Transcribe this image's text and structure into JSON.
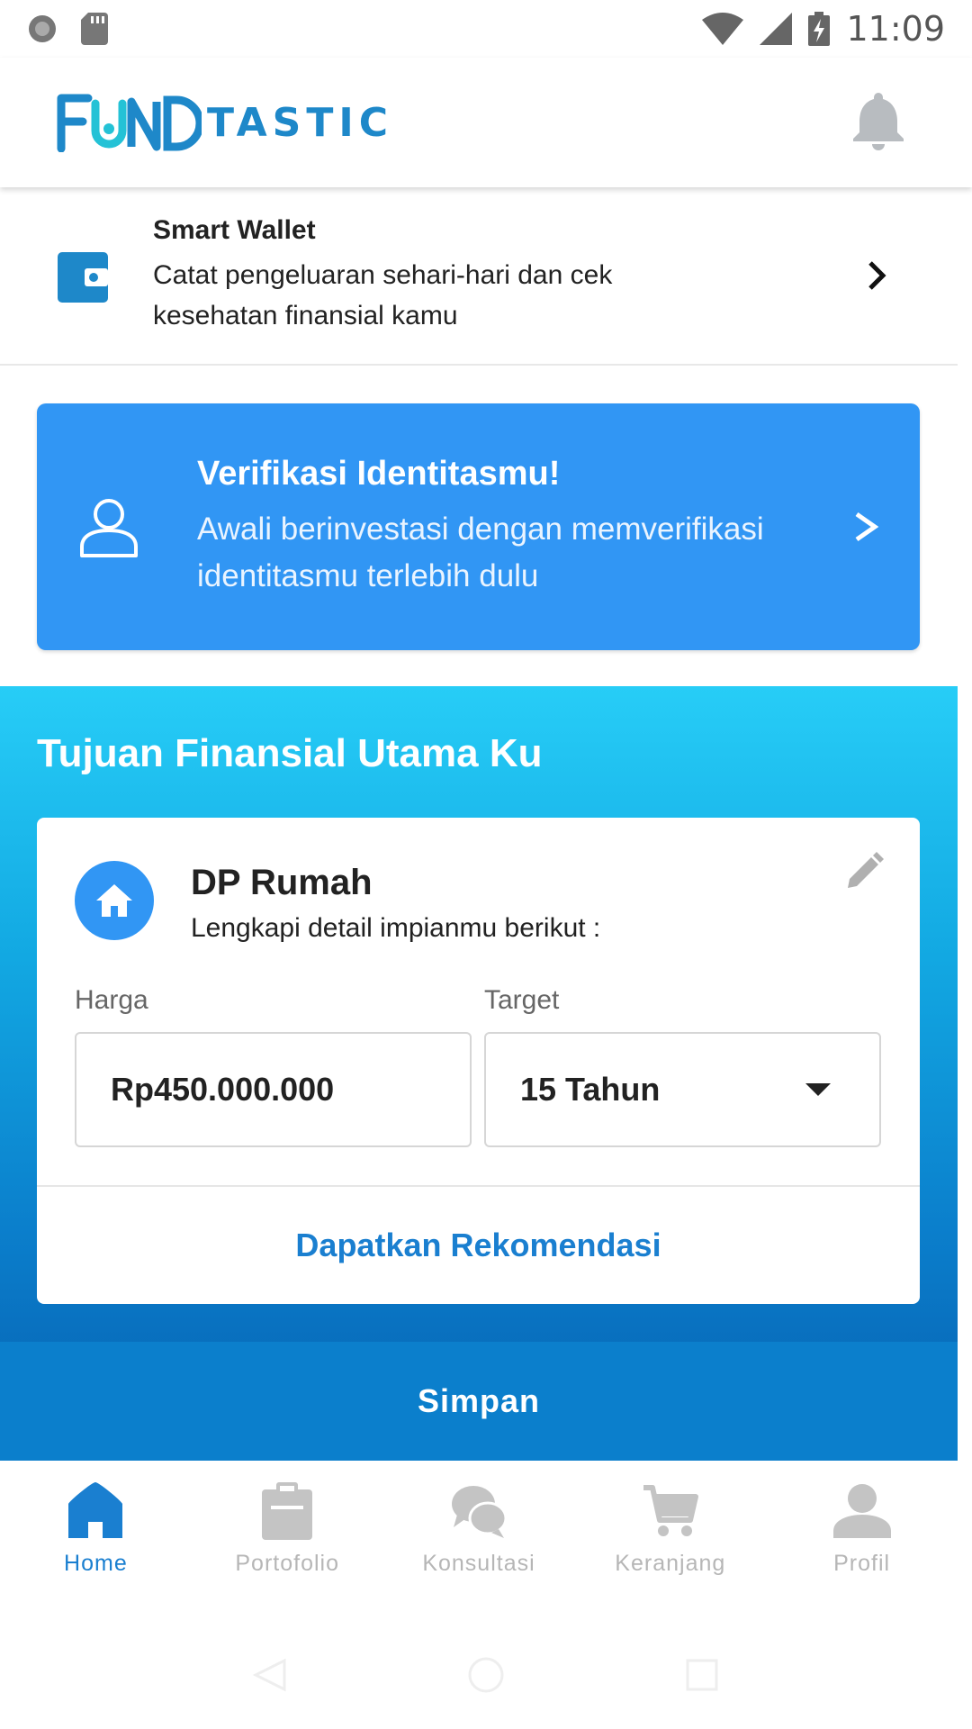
{
  "status_bar": {
    "time": "11:09",
    "icons": [
      "record-icon",
      "sd-card-icon",
      "wifi-icon",
      "signal-icon",
      "battery-charging-icon"
    ]
  },
  "header": {
    "logo_text_fund": "FUND",
    "logo_text_tastic": "TASTIC",
    "bell_icon": "bell-icon"
  },
  "smart_wallet": {
    "title": "Smart Wallet",
    "description": "Catat pengeluaran sehari-hari dan cek kesehatan finansial kamu",
    "icon": "wallet-icon"
  },
  "verify_banner": {
    "title": "Verifikasi Identitasmu!",
    "description": "Awali berinvestasi dengan memverifikasi identitasmu terlebih dulu",
    "icon": "user-outline-icon"
  },
  "goal": {
    "heading": "Tujuan Finansial Utama Ku",
    "title": "DP Rumah",
    "subtitle": "Lengkapi detail impianmu berikut :",
    "price_label": "Harga",
    "price_value": "Rp450.000.000",
    "target_label": "Target",
    "target_value": "15 Tahun",
    "recommend_label": "Dapatkan Rekomendasi",
    "save_label": "Simpan"
  },
  "bottom_nav": {
    "items": [
      {
        "label": "Home",
        "icon": "home-icon",
        "active": true
      },
      {
        "label": "Portofolio",
        "icon": "clipboard-icon",
        "active": false
      },
      {
        "label": "Konsultasi",
        "icon": "chat-icon",
        "active": false
      },
      {
        "label": "Keranjang",
        "icon": "cart-icon",
        "active": false
      },
      {
        "label": "Profil",
        "icon": "profile-icon",
        "active": false
      }
    ]
  },
  "colors": {
    "brand_blue": "#1e88c9",
    "banner_blue": "#3196f4",
    "active_nav": "#1a7fd0",
    "inactive_nav": "#b6b6b6"
  }
}
